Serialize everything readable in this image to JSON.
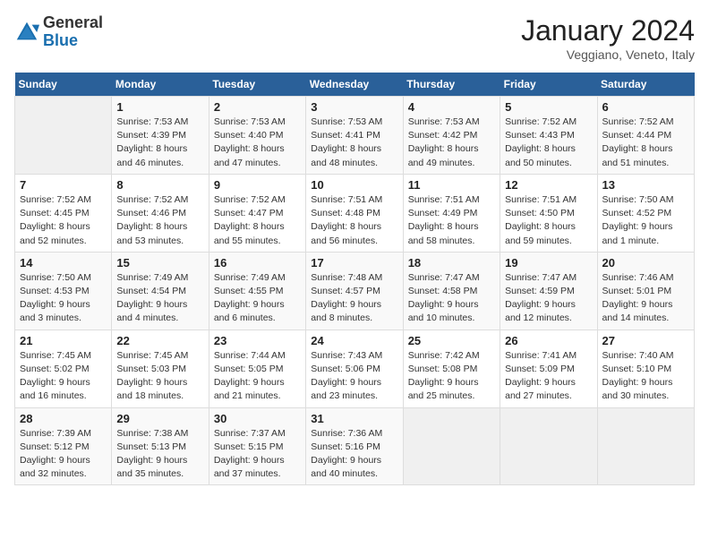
{
  "header": {
    "logo_general": "General",
    "logo_blue": "Blue",
    "month_title": "January 2024",
    "subtitle": "Veggiano, Veneto, Italy"
  },
  "weekdays": [
    "Sunday",
    "Monday",
    "Tuesday",
    "Wednesday",
    "Thursday",
    "Friday",
    "Saturday"
  ],
  "weeks": [
    [
      {
        "day": "",
        "info": ""
      },
      {
        "day": "1",
        "info": "Sunrise: 7:53 AM\nSunset: 4:39 PM\nDaylight: 8 hours\nand 46 minutes."
      },
      {
        "day": "2",
        "info": "Sunrise: 7:53 AM\nSunset: 4:40 PM\nDaylight: 8 hours\nand 47 minutes."
      },
      {
        "day": "3",
        "info": "Sunrise: 7:53 AM\nSunset: 4:41 PM\nDaylight: 8 hours\nand 48 minutes."
      },
      {
        "day": "4",
        "info": "Sunrise: 7:53 AM\nSunset: 4:42 PM\nDaylight: 8 hours\nand 49 minutes."
      },
      {
        "day": "5",
        "info": "Sunrise: 7:52 AM\nSunset: 4:43 PM\nDaylight: 8 hours\nand 50 minutes."
      },
      {
        "day": "6",
        "info": "Sunrise: 7:52 AM\nSunset: 4:44 PM\nDaylight: 8 hours\nand 51 minutes."
      }
    ],
    [
      {
        "day": "7",
        "info": "Sunrise: 7:52 AM\nSunset: 4:45 PM\nDaylight: 8 hours\nand 52 minutes."
      },
      {
        "day": "8",
        "info": "Sunrise: 7:52 AM\nSunset: 4:46 PM\nDaylight: 8 hours\nand 53 minutes."
      },
      {
        "day": "9",
        "info": "Sunrise: 7:52 AM\nSunset: 4:47 PM\nDaylight: 8 hours\nand 55 minutes."
      },
      {
        "day": "10",
        "info": "Sunrise: 7:51 AM\nSunset: 4:48 PM\nDaylight: 8 hours\nand 56 minutes."
      },
      {
        "day": "11",
        "info": "Sunrise: 7:51 AM\nSunset: 4:49 PM\nDaylight: 8 hours\nand 58 minutes."
      },
      {
        "day": "12",
        "info": "Sunrise: 7:51 AM\nSunset: 4:50 PM\nDaylight: 8 hours\nand 59 minutes."
      },
      {
        "day": "13",
        "info": "Sunrise: 7:50 AM\nSunset: 4:52 PM\nDaylight: 9 hours\nand 1 minute."
      }
    ],
    [
      {
        "day": "14",
        "info": "Sunrise: 7:50 AM\nSunset: 4:53 PM\nDaylight: 9 hours\nand 3 minutes."
      },
      {
        "day": "15",
        "info": "Sunrise: 7:49 AM\nSunset: 4:54 PM\nDaylight: 9 hours\nand 4 minutes."
      },
      {
        "day": "16",
        "info": "Sunrise: 7:49 AM\nSunset: 4:55 PM\nDaylight: 9 hours\nand 6 minutes."
      },
      {
        "day": "17",
        "info": "Sunrise: 7:48 AM\nSunset: 4:57 PM\nDaylight: 9 hours\nand 8 minutes."
      },
      {
        "day": "18",
        "info": "Sunrise: 7:47 AM\nSunset: 4:58 PM\nDaylight: 9 hours\nand 10 minutes."
      },
      {
        "day": "19",
        "info": "Sunrise: 7:47 AM\nSunset: 4:59 PM\nDaylight: 9 hours\nand 12 minutes."
      },
      {
        "day": "20",
        "info": "Sunrise: 7:46 AM\nSunset: 5:01 PM\nDaylight: 9 hours\nand 14 minutes."
      }
    ],
    [
      {
        "day": "21",
        "info": "Sunrise: 7:45 AM\nSunset: 5:02 PM\nDaylight: 9 hours\nand 16 minutes."
      },
      {
        "day": "22",
        "info": "Sunrise: 7:45 AM\nSunset: 5:03 PM\nDaylight: 9 hours\nand 18 minutes."
      },
      {
        "day": "23",
        "info": "Sunrise: 7:44 AM\nSunset: 5:05 PM\nDaylight: 9 hours\nand 21 minutes."
      },
      {
        "day": "24",
        "info": "Sunrise: 7:43 AM\nSunset: 5:06 PM\nDaylight: 9 hours\nand 23 minutes."
      },
      {
        "day": "25",
        "info": "Sunrise: 7:42 AM\nSunset: 5:08 PM\nDaylight: 9 hours\nand 25 minutes."
      },
      {
        "day": "26",
        "info": "Sunrise: 7:41 AM\nSunset: 5:09 PM\nDaylight: 9 hours\nand 27 minutes."
      },
      {
        "day": "27",
        "info": "Sunrise: 7:40 AM\nSunset: 5:10 PM\nDaylight: 9 hours\nand 30 minutes."
      }
    ],
    [
      {
        "day": "28",
        "info": "Sunrise: 7:39 AM\nSunset: 5:12 PM\nDaylight: 9 hours\nand 32 minutes."
      },
      {
        "day": "29",
        "info": "Sunrise: 7:38 AM\nSunset: 5:13 PM\nDaylight: 9 hours\nand 35 minutes."
      },
      {
        "day": "30",
        "info": "Sunrise: 7:37 AM\nSunset: 5:15 PM\nDaylight: 9 hours\nand 37 minutes."
      },
      {
        "day": "31",
        "info": "Sunrise: 7:36 AM\nSunset: 5:16 PM\nDaylight: 9 hours\nand 40 minutes."
      },
      {
        "day": "",
        "info": ""
      },
      {
        "day": "",
        "info": ""
      },
      {
        "day": "",
        "info": ""
      }
    ]
  ]
}
